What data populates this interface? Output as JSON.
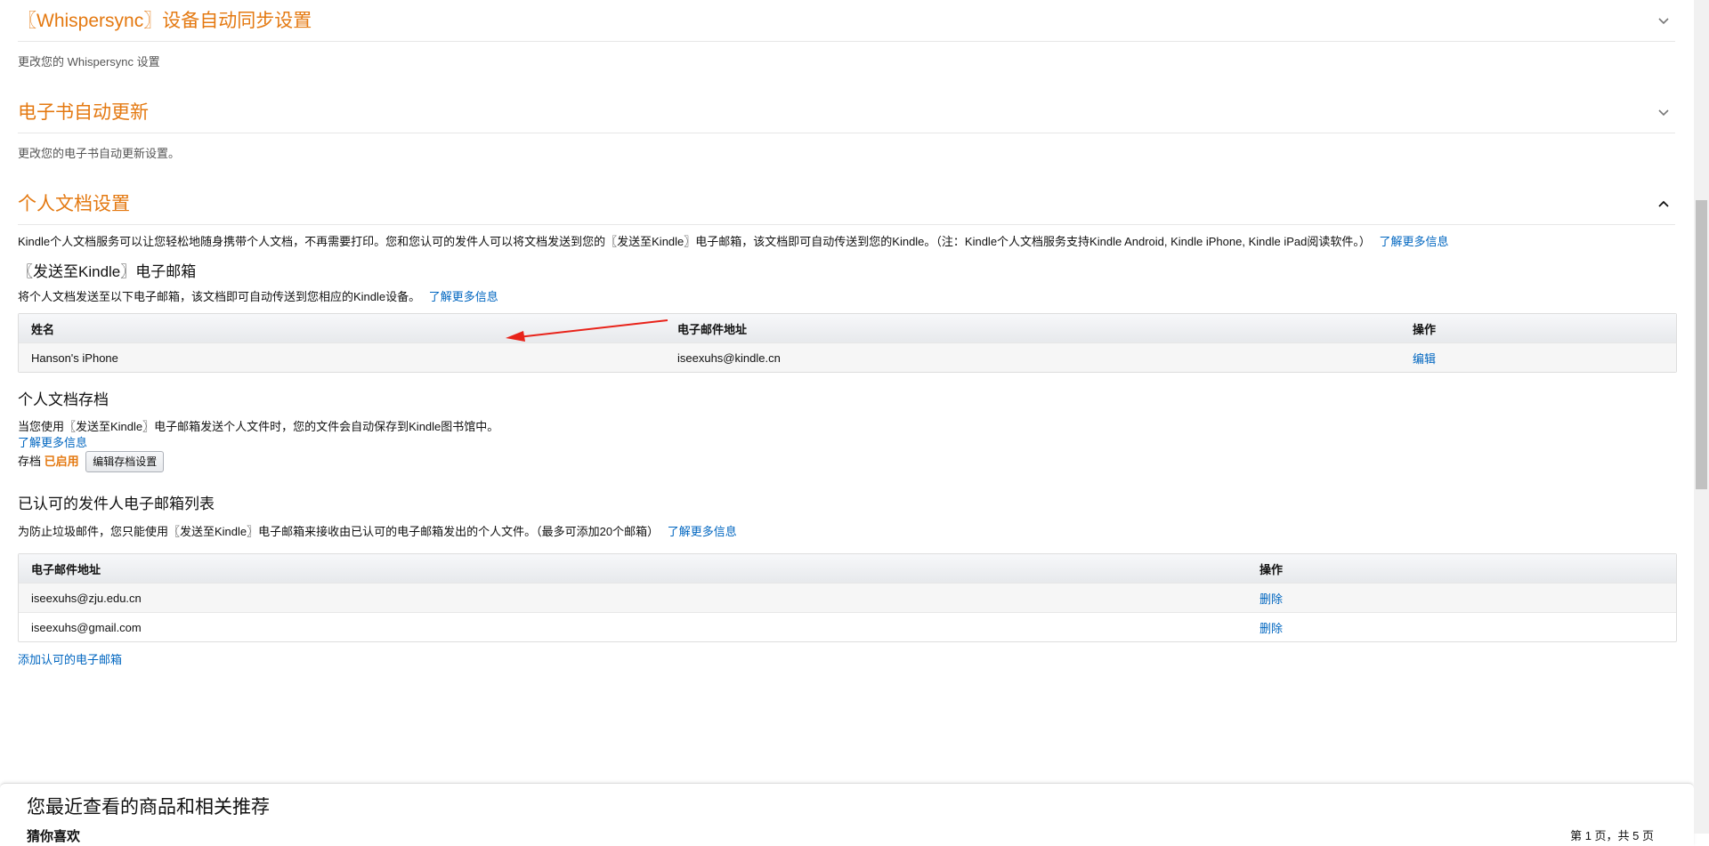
{
  "sections": {
    "whispersync": {
      "title": "〖Whispersync〗设备自动同步设置",
      "desc": "更改您的 Whispersync 设置"
    },
    "ebook_update": {
      "title": "电子书自动更新",
      "desc": "更改您的电子书自动更新设置。"
    },
    "personal_docs": {
      "title": "个人文档设置",
      "desc": "Kindle个人文档服务可以让您轻松地随身携带个人文档，不再需要打印。您和您认可的发件人可以将文档发送到您的〖发送至Kindle〗电子邮箱，该文档即可自动传送到您的Kindle。（注：Kindle个人文档服务支持Kindle Android, Kindle iPhone, Kindle iPad阅读软件。）",
      "learn_more": "了解更多信息"
    }
  },
  "send_to_kindle": {
    "title": "〖发送至Kindle〗电子邮箱",
    "desc": "将个人文档发送至以下电子邮箱，该文档即可自动传送到您相应的Kindle设备。",
    "learn_more": "了解更多信息",
    "columns": [
      "姓名",
      "电子邮件地址",
      "操作"
    ],
    "rows": [
      {
        "name": "Hanson's iPhone",
        "email": "iseexuhs@kindle.cn",
        "action": "编辑"
      }
    ]
  },
  "archive": {
    "title": "个人文档存档",
    "desc": "当您使用〖发送至Kindle〗电子邮箱发送个人文件时，您的文件会自动保存到Kindle图书馆中。",
    "learn_more": "了解更多信息",
    "status_label": "存档",
    "status_value": "已启用",
    "edit_button": "编辑存档设置"
  },
  "approved": {
    "title": "已认可的发件人电子邮箱列表",
    "desc": "为防止垃圾邮件，您只能使用〖发送至Kindle〗电子邮箱来接收由已认可的电子邮箱发出的个人文件。（最多可添加20个邮箱）",
    "learn_more": "了解更多信息",
    "columns": [
      "电子邮件地址",
      "操作"
    ],
    "rows": [
      {
        "email": "iseexuhs@zju.edu.cn",
        "action": "删除"
      },
      {
        "email": "iseexuhs@gmail.com",
        "action": "删除"
      }
    ],
    "add_link": "添加认可的电子邮箱"
  },
  "recommendations": {
    "title": "您最近查看的商品和相关推荐",
    "subtitle": "猜你喜欢",
    "page_indicator": "第 1 页，共 5 页"
  },
  "colors": {
    "accent_orange": "#e47911",
    "link_blue": "#0066c0",
    "annotation_red": "#e8231a"
  },
  "icons": {
    "collapsed": "chevron-down-icon",
    "expanded": "chevron-up-icon"
  }
}
